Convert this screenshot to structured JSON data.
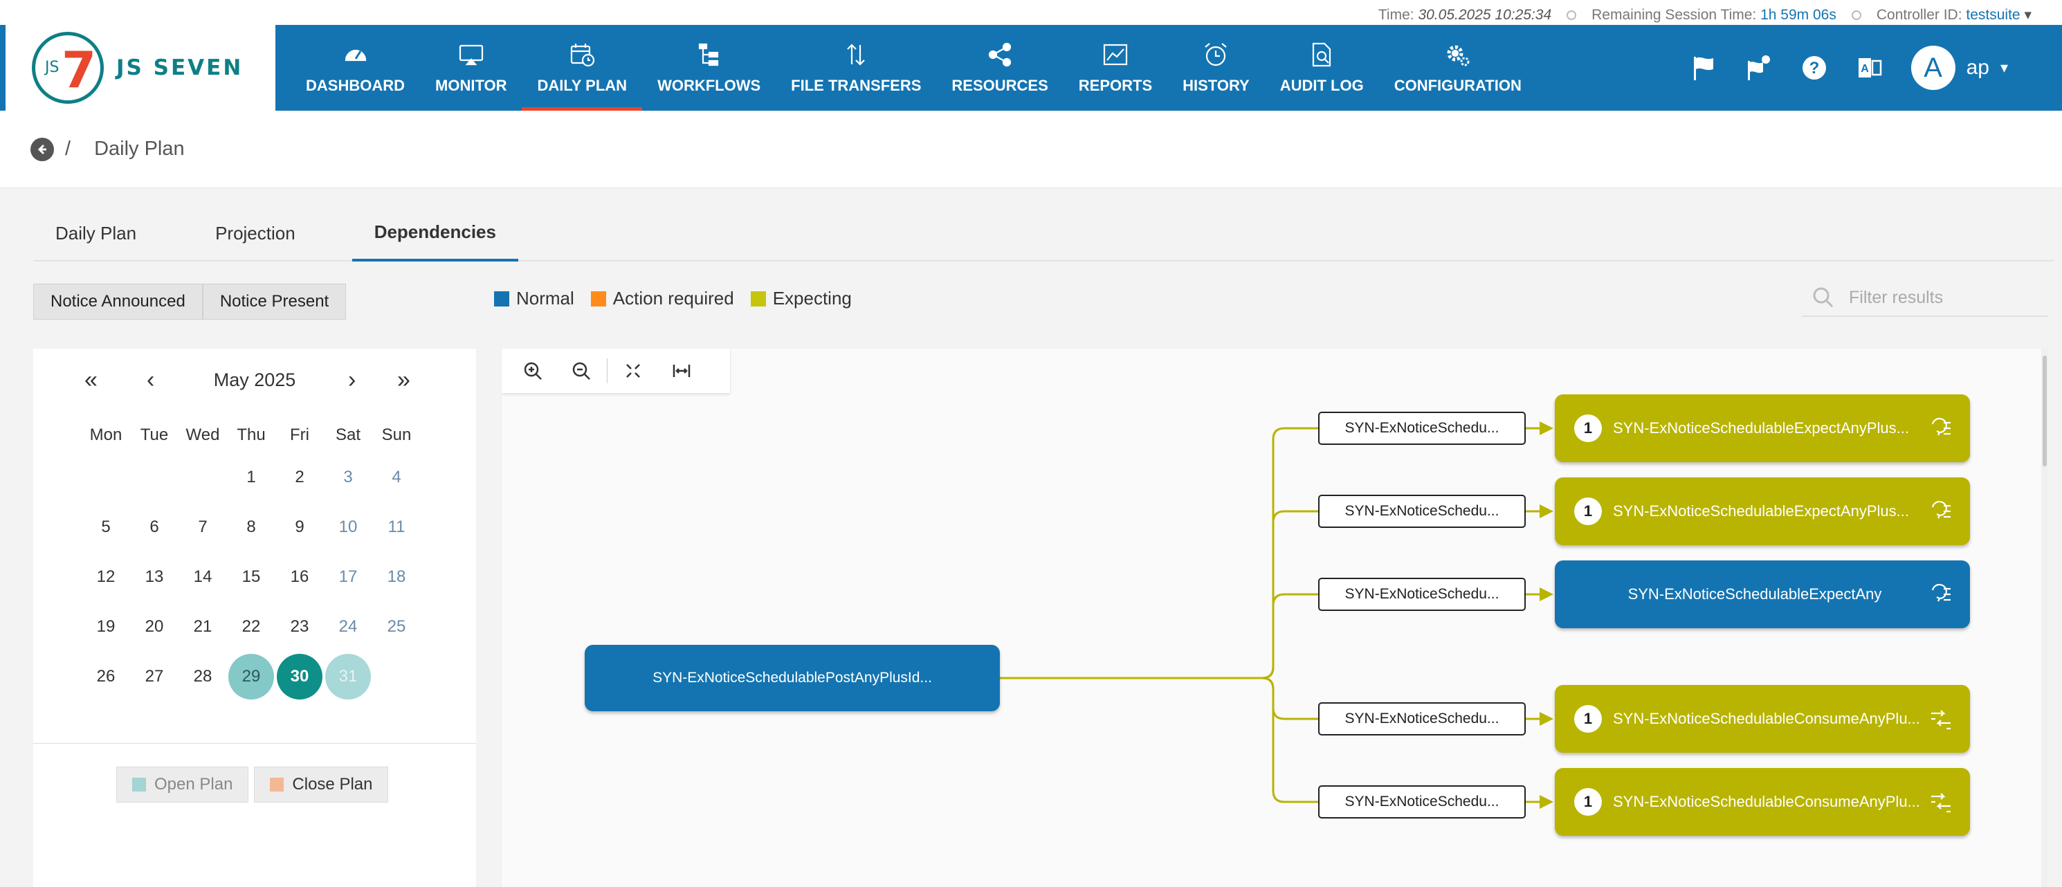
{
  "status": {
    "time_label": "Time:",
    "time_value": "30.05.2025 10:25:34",
    "session_label": "Remaining Session Time:",
    "session_value": "1h 59m 06s",
    "controller_label": "Controller ID:",
    "controller_value": "testsuite"
  },
  "logo": {
    "text": "JS SEVEN",
    "mark_small": "JS",
    "mark_big": "7"
  },
  "menu": [
    {
      "label": "DASHBOARD",
      "icon": "dashboard-icon"
    },
    {
      "label": "MONITOR",
      "icon": "monitor-icon"
    },
    {
      "label": "DAILY PLAN",
      "icon": "calendar-clock-icon",
      "active": true
    },
    {
      "label": "WORKFLOWS",
      "icon": "workflow-tree-icon"
    },
    {
      "label": "FILE TRANSFERS",
      "icon": "transfer-arrows-icon"
    },
    {
      "label": "RESOURCES",
      "icon": "share-nodes-icon"
    },
    {
      "label": "REPORTS",
      "icon": "chart-line-icon"
    },
    {
      "label": "HISTORY",
      "icon": "alarm-clock-icon"
    },
    {
      "label": "AUDIT LOG",
      "icon": "document-search-icon"
    },
    {
      "label": "CONFIGURATION",
      "icon": "gears-icon"
    }
  ],
  "user": {
    "avatar_letter": "A",
    "name": "ap"
  },
  "breadcrumb": {
    "sep": "/",
    "title": "Daily Plan"
  },
  "tabs": [
    {
      "label": "Daily Plan"
    },
    {
      "label": "Projection"
    },
    {
      "label": "Dependencies",
      "active": true
    }
  ],
  "filters": {
    "announced": "Notice Announced",
    "present": "Notice Present"
  },
  "legend": [
    {
      "label": "Normal",
      "color": "#1474b1"
    },
    {
      "label": "Action required",
      "color": "#ff8c1a"
    },
    {
      "label": "Expecting",
      "color": "#c6c50e"
    }
  ],
  "search": {
    "placeholder": "Filter results"
  },
  "calendar": {
    "month": "May 2025",
    "weekdays": [
      "Mon",
      "Tue",
      "Wed",
      "Thu",
      "Fri",
      "Sat",
      "Sun"
    ],
    "weeks": [
      [
        "",
        "",
        "",
        "1",
        "2",
        "3",
        "4"
      ],
      [
        "5",
        "6",
        "7",
        "8",
        "9",
        "10",
        "11"
      ],
      [
        "12",
        "13",
        "14",
        "15",
        "16",
        "17",
        "18"
      ],
      [
        "19",
        "20",
        "21",
        "22",
        "23",
        "24",
        "25"
      ],
      [
        "26",
        "27",
        "28",
        "29",
        "30",
        "31",
        ""
      ]
    ],
    "open_plan_days": [
      "29"
    ],
    "today": "30",
    "future_plan_days": [
      "31"
    ],
    "open_plan_label": "Open Plan",
    "close_plan_label": "Close Plan",
    "open_color": "#a4d4d4",
    "close_color": "#f3b994"
  },
  "graph": {
    "source": "SYN-ExNoticeSchedulablePostAnyPlusId...",
    "edges": [
      {
        "notice": "SYN-ExNoticeSchedu...",
        "workflow": "SYN-ExNoticeSchedulableExpectAnyPlus...",
        "state": "expecting",
        "count": "1",
        "icon": "expect-notice-icon"
      },
      {
        "notice": "SYN-ExNoticeSchedu...",
        "workflow": "SYN-ExNoticeSchedulableExpectAnyPlus...",
        "state": "expecting",
        "count": "1",
        "icon": "expect-notice-icon"
      },
      {
        "notice": "SYN-ExNoticeSchedu...",
        "workflow": "SYN-ExNoticeSchedulableExpectAny",
        "state": "normal",
        "count": "",
        "icon": "expect-notice-icon"
      },
      {
        "notice": "SYN-ExNoticeSchedu...",
        "workflow": "SYN-ExNoticeSchedulableConsumeAnyPlu...",
        "state": "expecting",
        "count": "1",
        "icon": "consume-notice-icon"
      },
      {
        "notice": "SYN-ExNoticeSchedu...",
        "workflow": "SYN-ExNoticeSchedulableConsumeAnyPlu...",
        "state": "expecting",
        "count": "1",
        "icon": "consume-notice-icon"
      }
    ],
    "edge_color": "#b8b401"
  }
}
